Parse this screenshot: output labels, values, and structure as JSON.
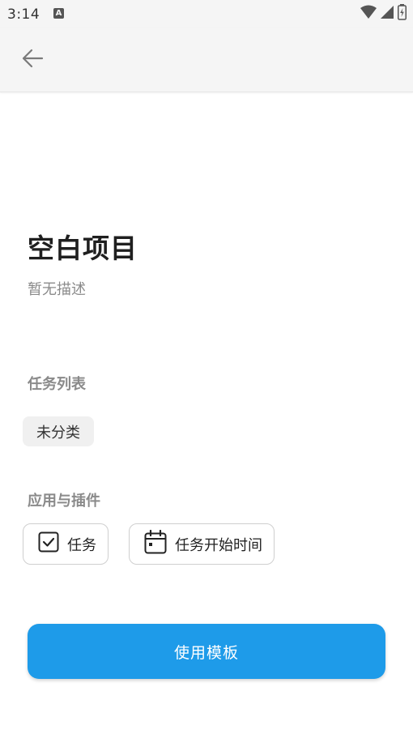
{
  "status_bar": {
    "time": "3:14",
    "notification_icon_glyph": "A",
    "icons": [
      "wifi-icon",
      "signal-icon",
      "battery-icon"
    ]
  },
  "app_bar": {
    "back_icon": "arrow-left-icon"
  },
  "template": {
    "title": "空白项目",
    "description": "暂无描述"
  },
  "task_lists": {
    "label": "任务列表",
    "items": [
      "未分类"
    ]
  },
  "plugins": {
    "label": "应用与插件",
    "items": [
      {
        "icon": "checkbox-icon",
        "label": "任务"
      },
      {
        "icon": "calendar-icon",
        "label": "任务开始时间"
      }
    ]
  },
  "action": {
    "use_template_label": "使用模板"
  },
  "colors": {
    "accent": "#1e9be9",
    "app_bar_bg": "#f5f5f5",
    "muted_text": "#8a8a8a",
    "chip_bg": "#f0f0f0"
  }
}
